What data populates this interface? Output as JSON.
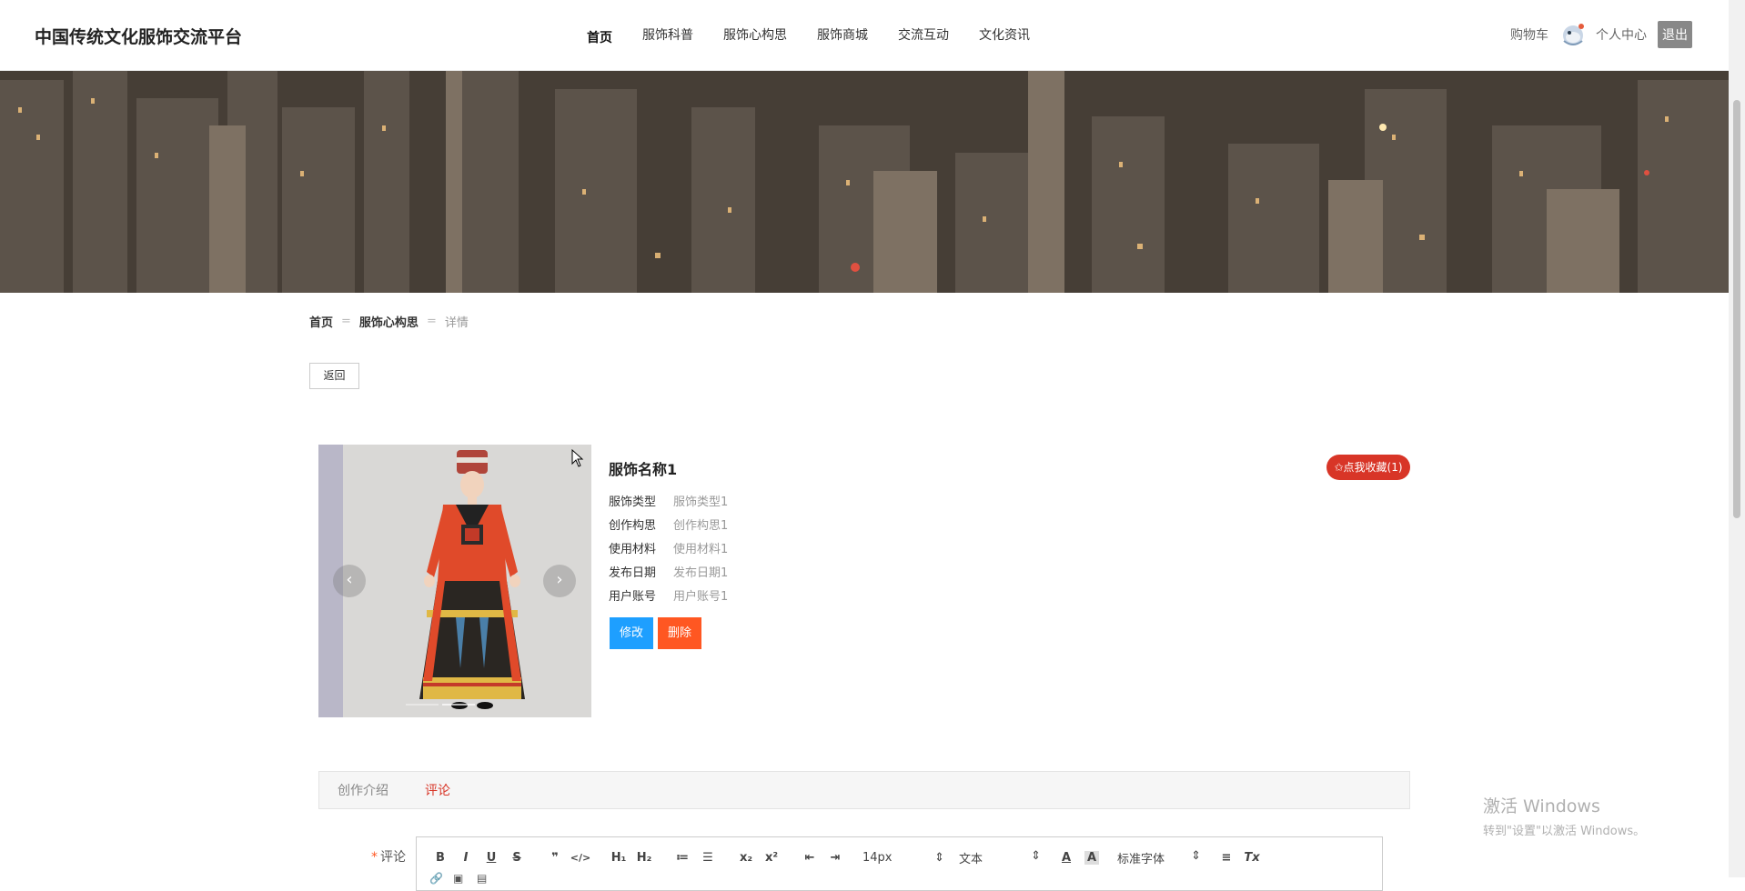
{
  "header": {
    "site_title": "中国传统文化服饰交流平台",
    "nav": [
      "首页",
      "服饰科普",
      "服饰心构思",
      "服饰商城",
      "交流互动",
      "文化资讯"
    ],
    "cart": "购物车",
    "user_center": "个人中心",
    "logout": "退出"
  },
  "breadcrumb": {
    "home": "首页",
    "section": "服饰心构思",
    "current": "详情",
    "separator": "="
  },
  "back_button": "返回",
  "product": {
    "name": "服饰名称1",
    "favorite_button": "✩点我收藏(1)",
    "attributes": [
      {
        "label": "服饰类型",
        "value": "服饰类型1"
      },
      {
        "label": "创作构思",
        "value": "创作构思1"
      },
      {
        "label": "使用材料",
        "value": "使用材料1"
      },
      {
        "label": "发布日期",
        "value": "发布日期1"
      },
      {
        "label": "用户账号",
        "value": "用户账号1"
      }
    ],
    "edit_button": "修改",
    "delete_button": "删除",
    "carousel": {
      "prev": "‹",
      "next": "›"
    }
  },
  "tabs": [
    {
      "label": "创作介绍",
      "active": false
    },
    {
      "label": "评论",
      "active": true
    }
  ],
  "comment": {
    "label": "评论",
    "required_mark": "*",
    "toolbar": {
      "bold": "B",
      "italic": "I",
      "underline": "U",
      "strike": "S",
      "quote": "❞",
      "code": "</>",
      "h1": "H₁",
      "h2": "H₂",
      "ordered_list": "≔",
      "bullet_list": "☰",
      "sub": "x₂",
      "sup": "x²",
      "outdent": "⇤",
      "indent": "⇥",
      "size_value": "14px",
      "type_value": "文本",
      "font_value": "标准字体",
      "align": "≡",
      "clear": "Tx"
    }
  },
  "watermark": {
    "title": "激活 Windows",
    "subtitle": "转到\"设置\"以激活 Windows。"
  },
  "colors": {
    "accent_red": "#d83527",
    "edit_blue": "#1e9fff",
    "delete_orange": "#ff5722"
  }
}
